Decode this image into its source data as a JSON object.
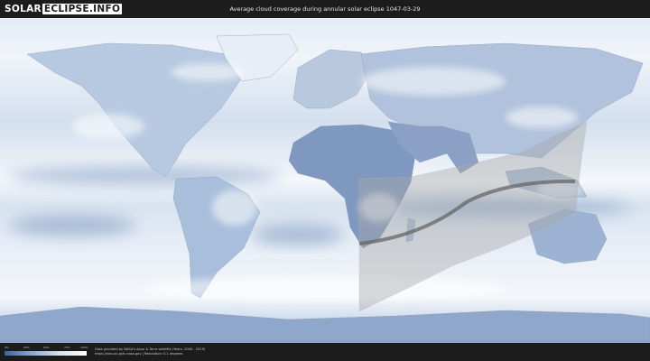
{
  "header": {
    "logo_part1": "SOLAR",
    "logo_part2": "ECLIPSE.INFO",
    "title": "Average cloud coverage during annular solar eclipse 1047-03-29"
  },
  "legend": {
    "ticks": [
      "0%",
      "25%",
      "50%",
      "75%",
      "100%"
    ],
    "colors": [
      "#3f6499",
      "#8aa9cf",
      "#d6e3f1",
      "#ffffff"
    ]
  },
  "footer": {
    "credit_line1": "Data provided by NASA's Aqua & Terra satellite (Years: 2000 - 2019)",
    "credit_line2": "https://neo.sci.gsfc.nasa.gov | Resolution: 0.1 degrees"
  },
  "colors": {
    "background": "#1c1c1c",
    "cloud_white": "#f2f6fb",
    "clear_sky_blue": "#4a6ea3",
    "eclipse_shadow": "#a6a6a6",
    "central_path": "#666666"
  }
}
